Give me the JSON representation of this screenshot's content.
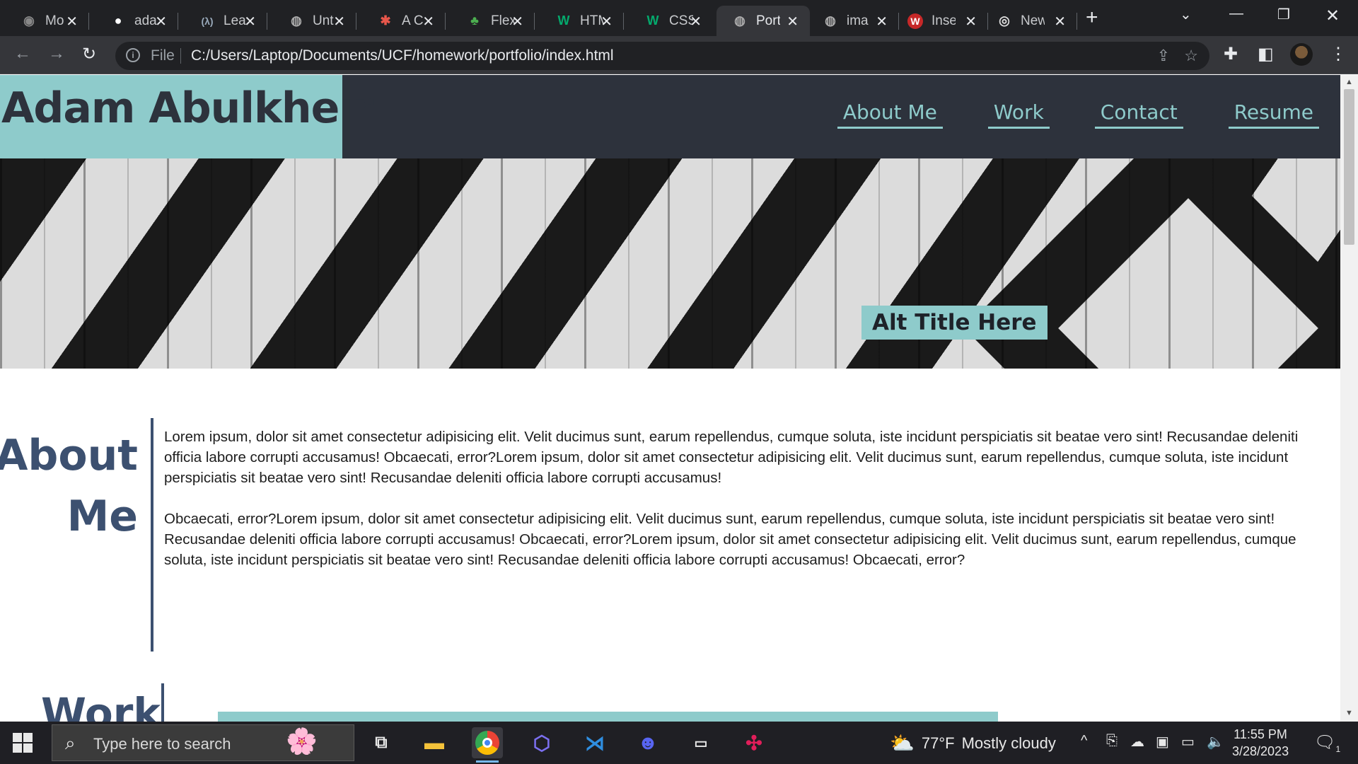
{
  "browser": {
    "tabs": [
      {
        "title": "Mo",
        "icon": "hammer-icon",
        "active": false
      },
      {
        "title": "ada",
        "icon": "github-icon",
        "active": false
      },
      {
        "title": "Lea",
        "icon": "lambda-icon",
        "active": false
      },
      {
        "title": "Unt",
        "icon": "globe-icon",
        "active": false
      },
      {
        "title": "A C",
        "icon": "asterisk-icon",
        "active": false
      },
      {
        "title": "Flex",
        "icon": "frog-icon",
        "active": false
      },
      {
        "title": "HTM",
        "icon": "w3-icon",
        "active": false
      },
      {
        "title": "CSS",
        "icon": "w3-icon",
        "active": false
      },
      {
        "title": "Port",
        "icon": "globe-icon",
        "active": true
      },
      {
        "title": "ima",
        "icon": "globe-icon",
        "active": false
      },
      {
        "title": "Inse",
        "icon": "w-logo-icon",
        "active": false
      },
      {
        "title": "New",
        "icon": "chrome-icon",
        "active": false
      }
    ],
    "address": {
      "scheme": "File",
      "url": "C:/Users/Laptop/Documents/UCF/homework/portfolio/index.html"
    }
  },
  "site": {
    "name": "Adam Abulkheir",
    "nav": [
      {
        "label": "About Me"
      },
      {
        "label": "Work"
      },
      {
        "label": "Contact"
      },
      {
        "label": "Resume"
      }
    ],
    "hero_title": "Alt Title Here",
    "about": {
      "heading_line1": "About",
      "heading_line2": "Me",
      "paragraphs": [
        "Lorem ipsum, dolor sit amet consectetur adipisicing elit. Velit ducimus sunt, earum repellendus, cumque soluta, iste incidunt perspiciatis sit beatae vero sint! Recusandae deleniti officia labore corrupti accusamus! Obcaecati, error?Lorem ipsum, dolor sit amet consectetur adipisicing elit. Velit ducimus sunt, earum repellendus, cumque soluta, iste incidunt perspiciatis sit beatae vero sint! Recusandae deleniti officia labore corrupti accusamus!",
        "Obcaecati, error?Lorem ipsum, dolor sit amet consectetur adipisicing elit. Velit ducimus sunt, earum repellendus, cumque soluta, iste incidunt perspiciatis sit beatae vero sint! Recusandae deleniti officia labore corrupti accusamus! Obcaecati, error?Lorem ipsum, dolor sit amet consectetur adipisicing elit. Velit ducimus sunt, earum repellendus, cumque soluta, iste incidunt perspiciatis sit beatae vero sint! Recusandae deleniti officia labore corrupti accusamus! Obcaecati, error?"
      ]
    },
    "work_heading": "Work",
    "colors": {
      "header_bg": "#2d323c",
      "accent": "#8ecbcb",
      "heading": "#3c5070"
    }
  },
  "taskbar": {
    "search_placeholder": "Type here to search",
    "weather": {
      "temp": "77°F",
      "condition": "Mostly cloudy"
    },
    "time": "11:55 PM",
    "date": "3/28/2023",
    "notification_count": "1",
    "apps": [
      "task-view-icon",
      "file-explorer-icon",
      "chrome-icon",
      "copilot-icon",
      "vscode-icon",
      "discord-icon",
      "terminal-icon",
      "slack-icon"
    ]
  }
}
